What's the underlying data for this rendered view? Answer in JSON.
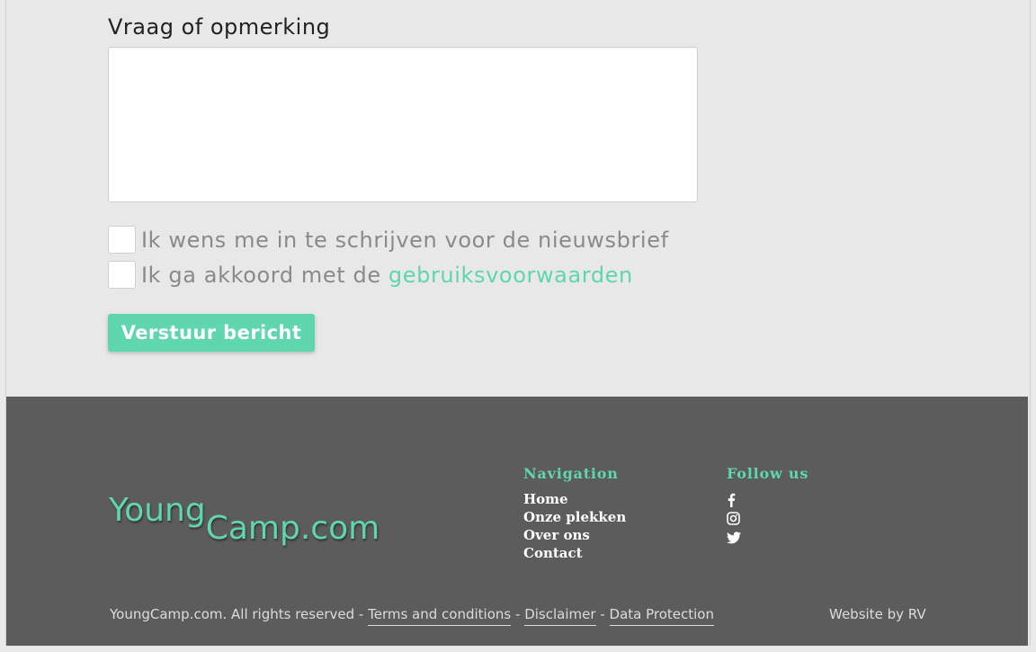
{
  "form": {
    "comment_label": "Vraag of opmerking",
    "comment_value": "",
    "newsletter_label": "Ik wens me in te schrijven voor de nieuwsbrief",
    "terms_prefix": "Ik ga akkoord met de",
    "terms_link": "gebruiksvoorwaarden",
    "submit_label": "Verstuur bericht"
  },
  "footer": {
    "logo_part1": "Young",
    "logo_part2": "Camp.com",
    "navigation_title": "Navigation",
    "nav_items": [
      "Home",
      "Onze plekken",
      "Over ons",
      "Contact"
    ],
    "follow_title": "Follow us",
    "social_icons": [
      "facebook-icon",
      "instagram-icon",
      "twitter-icon"
    ],
    "copyright": "YoungCamp.com. All rights reserved",
    "separator": "-",
    "terms": "Terms and conditions",
    "disclaimer": "Disclaimer",
    "data_protection": "Data Protection",
    "credit": "Website by RV"
  },
  "colors": {
    "accent": "#5fd6ad",
    "footer_bg": "#5c5c5c",
    "page_bg": "#e8e8e8"
  }
}
